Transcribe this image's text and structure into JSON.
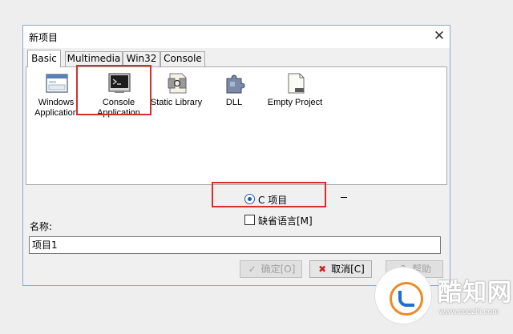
{
  "window": {
    "title": "新项目",
    "close_glyph": "✕"
  },
  "tabs": [
    {
      "label": "Basic",
      "active": true
    },
    {
      "label": "Multimedia",
      "active": false
    },
    {
      "label": "Win32",
      "active": false
    },
    {
      "label": "Console",
      "active": false
    }
  ],
  "templates": [
    {
      "label": "Windows Application",
      "icon": "window-app-icon"
    },
    {
      "label": "Console Application",
      "icon": "console-app-icon"
    },
    {
      "label": "Static Library",
      "icon": "static-library-icon"
    },
    {
      "label": "DLL",
      "icon": "dll-puzzle-icon"
    },
    {
      "label": "Empty Project",
      "icon": "empty-project-icon"
    }
  ],
  "language": {
    "radio_label": "C 项目",
    "selected": true
  },
  "default_language": {
    "label": "缺省语言[M]",
    "checked": false
  },
  "name": {
    "label": "名称:",
    "value": "项目1"
  },
  "buttons": {
    "ok": {
      "label": "确定[O]",
      "icon": "check-icon",
      "enabled": false
    },
    "cancel": {
      "label": "取消[C]",
      "icon": "x-icon",
      "enabled": true
    },
    "help": {
      "label": "帮助",
      "icon": "help-icon",
      "enabled": false
    }
  },
  "watermark": {
    "text": "酷知网",
    "url": "www.coozhi.com"
  },
  "colors": {
    "highlight": "#d32f2f",
    "accent": "#1a5fb4",
    "watermark_orange": "#f08a24"
  }
}
